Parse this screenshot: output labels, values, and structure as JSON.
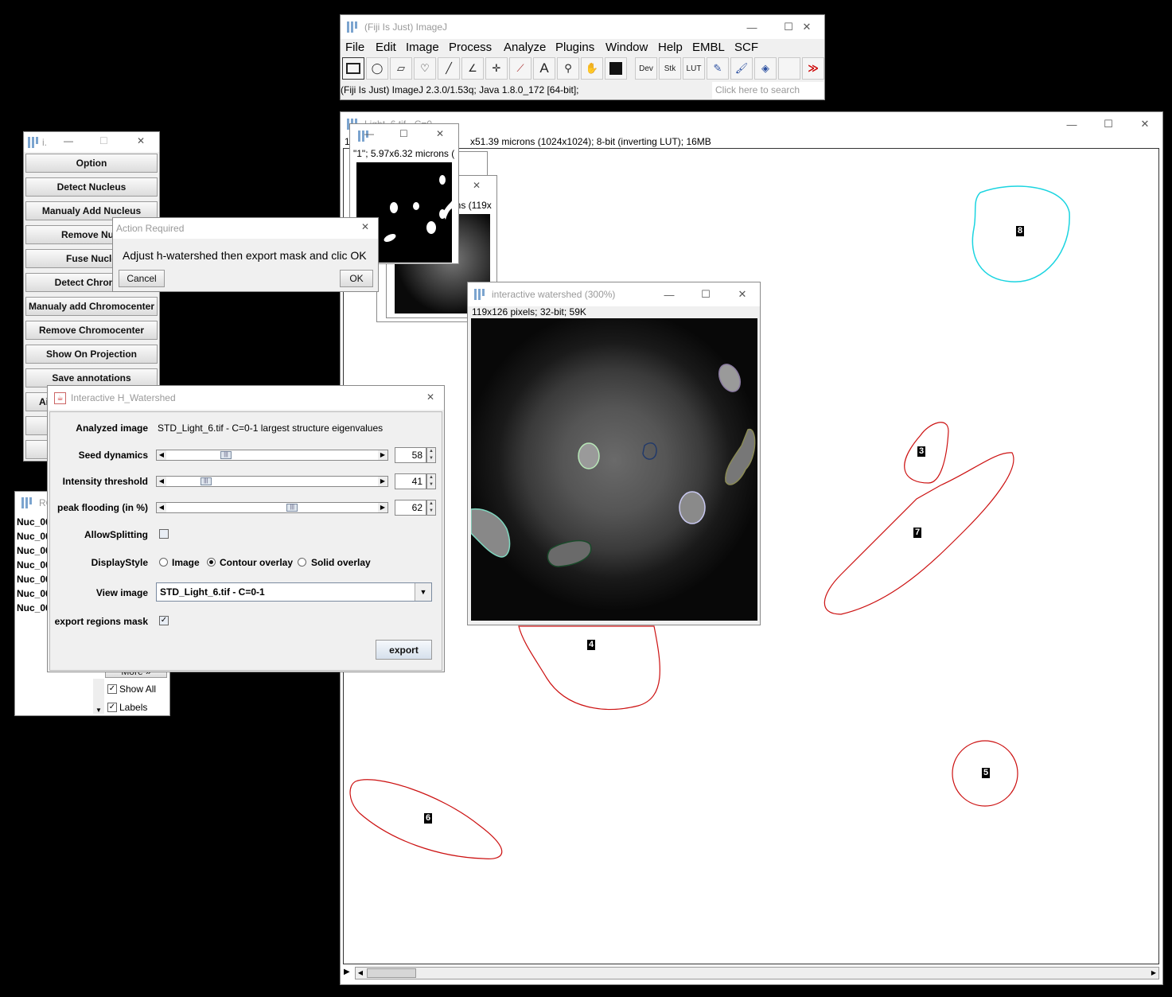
{
  "imagej": {
    "title": "(Fiji Is Just) ImageJ",
    "menus": [
      "File",
      "Edit",
      "Image",
      "Process",
      "Analyze",
      "Plugins",
      "Window",
      "Help",
      "EMBL",
      "SCF"
    ],
    "tools": [
      "rectangle-tool",
      "oval-tool",
      "polygon-tool",
      "freehand-tool",
      "line-tool",
      "angle-tool",
      "point-tool",
      "wand-tool",
      "text-tool",
      "magnifier-tool",
      "hand-tool",
      "color-picker-tool",
      "Dev",
      "Stk",
      "LUT",
      "pencil-tool",
      "brush-tool",
      "flood-fill-tool",
      "empty-slot",
      "more-tools"
    ],
    "dev_label": "Dev",
    "stk_label": "Stk",
    "lut_label": "LUT",
    "more_glyph": "≫",
    "status": "(Fiji Is Just) ImageJ 2.3.0/1.53q; Java 1.8.0_172 [64-bit];",
    "search_placeholder": "Click here to search"
  },
  "main_image": {
    "title": "Light_6.tif - C=0",
    "info_prefix": "1",
    "info": "x51.39 microns (1024x1024); 8-bit (inverting LUT); 16MB",
    "roi_labels": [
      "8",
      "3",
      "7",
      "4",
      "5",
      "6"
    ]
  },
  "mask_window": {
    "info": "\"1\"; 5.97x6.32 microns ("
  },
  "stack_window": {
    "info": "ons (119x"
  },
  "plugin_panel": {
    "title": "i.",
    "buttons": [
      "Option",
      "Detect Nucleus",
      "Manualy Add Nucleus",
      "Remove Nucl",
      "Fuse Nucle",
      "Detect Chromoc",
      "Manualy add Chromocenter",
      "Remove Chromocenter",
      "Show On Projection",
      "Save annotations",
      "Ai"
    ]
  },
  "roi_manager": {
    "title": "RO",
    "items": [
      "Nuc_00",
      "Nuc_00",
      "Nuc_00",
      "Nuc_00",
      "Nuc_00",
      "Nuc_00",
      "Nuc_00"
    ],
    "more_label": "More »",
    "show_all": "Show All",
    "labels": "Labels"
  },
  "action_dialog": {
    "title": "Action Required",
    "message": "Adjust h-watershed then export mask and clic OK",
    "cancel": "Cancel",
    "ok": "OK"
  },
  "watershed_preview": {
    "title": "interactive watershed (300%)",
    "info": "119x126 pixels; 32-bit; 59K"
  },
  "hwatershed": {
    "title": "Interactive H_Watershed",
    "analyzed_label": "Analyzed image",
    "analyzed_value": "STD_Light_6.tif - C=0-1 largest structure eigenvalues",
    "seed_label": "Seed dynamics",
    "seed_value": "58",
    "seed_fraction": 0.27,
    "intensity_label": "Intensity threshold",
    "intensity_value": "41",
    "intensity_fraction": 0.17,
    "flooding_label": "peak flooding (in %)",
    "flooding_value": "62",
    "flooding_fraction": 0.6,
    "allow_label": "AllowSplitting",
    "display_label": "DisplayStyle",
    "opt_image": "Image",
    "opt_contour": "Contour overlay",
    "opt_solid": "Solid overlay",
    "view_label": "View image",
    "view_value": "STD_Light_6.tif - C=0-1",
    "export_mask_label": "export regions mask",
    "export_button": "export"
  },
  "colors": {
    "roi_red": "#cc1111",
    "roi_cyan": "#1ad4e0"
  }
}
